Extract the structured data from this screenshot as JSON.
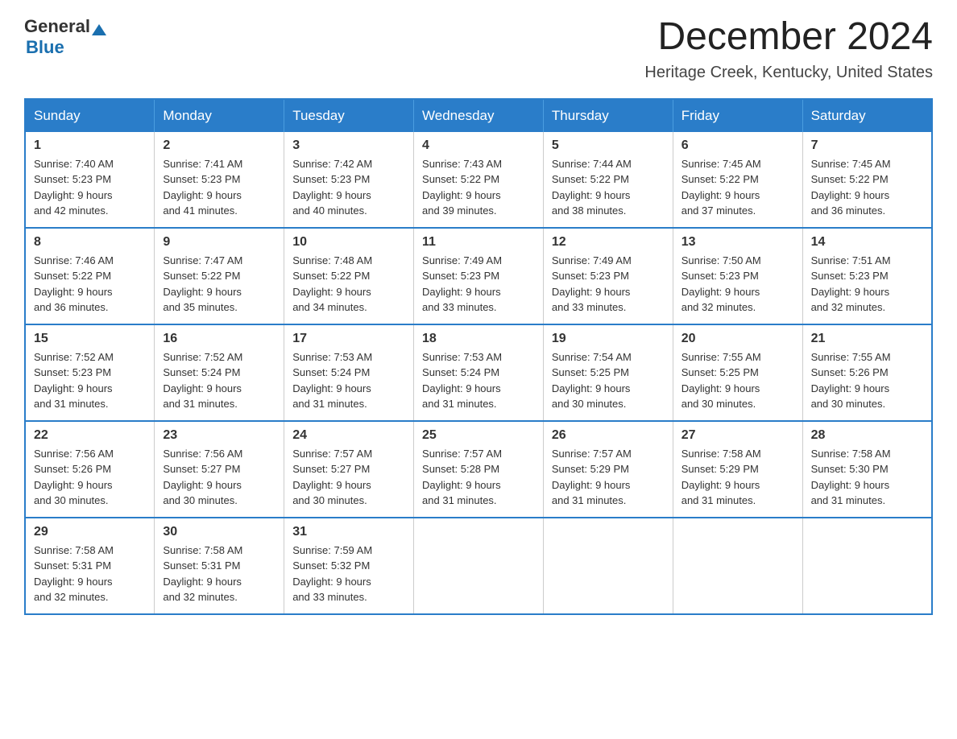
{
  "header": {
    "logo_general": "General",
    "logo_blue": "Blue",
    "month_title": "December 2024",
    "location": "Heritage Creek, Kentucky, United States"
  },
  "days_of_week": [
    "Sunday",
    "Monday",
    "Tuesday",
    "Wednesday",
    "Thursday",
    "Friday",
    "Saturday"
  ],
  "weeks": [
    [
      {
        "day": "1",
        "sunrise": "7:40 AM",
        "sunset": "5:23 PM",
        "daylight": "9 hours and 42 minutes."
      },
      {
        "day": "2",
        "sunrise": "7:41 AM",
        "sunset": "5:23 PM",
        "daylight": "9 hours and 41 minutes."
      },
      {
        "day": "3",
        "sunrise": "7:42 AM",
        "sunset": "5:23 PM",
        "daylight": "9 hours and 40 minutes."
      },
      {
        "day": "4",
        "sunrise": "7:43 AM",
        "sunset": "5:22 PM",
        "daylight": "9 hours and 39 minutes."
      },
      {
        "day": "5",
        "sunrise": "7:44 AM",
        "sunset": "5:22 PM",
        "daylight": "9 hours and 38 minutes."
      },
      {
        "day": "6",
        "sunrise": "7:45 AM",
        "sunset": "5:22 PM",
        "daylight": "9 hours and 37 minutes."
      },
      {
        "day": "7",
        "sunrise": "7:45 AM",
        "sunset": "5:22 PM",
        "daylight": "9 hours and 36 minutes."
      }
    ],
    [
      {
        "day": "8",
        "sunrise": "7:46 AM",
        "sunset": "5:22 PM",
        "daylight": "9 hours and 36 minutes."
      },
      {
        "day": "9",
        "sunrise": "7:47 AM",
        "sunset": "5:22 PM",
        "daylight": "9 hours and 35 minutes."
      },
      {
        "day": "10",
        "sunrise": "7:48 AM",
        "sunset": "5:22 PM",
        "daylight": "9 hours and 34 minutes."
      },
      {
        "day": "11",
        "sunrise": "7:49 AM",
        "sunset": "5:23 PM",
        "daylight": "9 hours and 33 minutes."
      },
      {
        "day": "12",
        "sunrise": "7:49 AM",
        "sunset": "5:23 PM",
        "daylight": "9 hours and 33 minutes."
      },
      {
        "day": "13",
        "sunrise": "7:50 AM",
        "sunset": "5:23 PM",
        "daylight": "9 hours and 32 minutes."
      },
      {
        "day": "14",
        "sunrise": "7:51 AM",
        "sunset": "5:23 PM",
        "daylight": "9 hours and 32 minutes."
      }
    ],
    [
      {
        "day": "15",
        "sunrise": "7:52 AM",
        "sunset": "5:23 PM",
        "daylight": "9 hours and 31 minutes."
      },
      {
        "day": "16",
        "sunrise": "7:52 AM",
        "sunset": "5:24 PM",
        "daylight": "9 hours and 31 minutes."
      },
      {
        "day": "17",
        "sunrise": "7:53 AM",
        "sunset": "5:24 PM",
        "daylight": "9 hours and 31 minutes."
      },
      {
        "day": "18",
        "sunrise": "7:53 AM",
        "sunset": "5:24 PM",
        "daylight": "9 hours and 31 minutes."
      },
      {
        "day": "19",
        "sunrise": "7:54 AM",
        "sunset": "5:25 PM",
        "daylight": "9 hours and 30 minutes."
      },
      {
        "day": "20",
        "sunrise": "7:55 AM",
        "sunset": "5:25 PM",
        "daylight": "9 hours and 30 minutes."
      },
      {
        "day": "21",
        "sunrise": "7:55 AM",
        "sunset": "5:26 PM",
        "daylight": "9 hours and 30 minutes."
      }
    ],
    [
      {
        "day": "22",
        "sunrise": "7:56 AM",
        "sunset": "5:26 PM",
        "daylight": "9 hours and 30 minutes."
      },
      {
        "day": "23",
        "sunrise": "7:56 AM",
        "sunset": "5:27 PM",
        "daylight": "9 hours and 30 minutes."
      },
      {
        "day": "24",
        "sunrise": "7:57 AM",
        "sunset": "5:27 PM",
        "daylight": "9 hours and 30 minutes."
      },
      {
        "day": "25",
        "sunrise": "7:57 AM",
        "sunset": "5:28 PM",
        "daylight": "9 hours and 31 minutes."
      },
      {
        "day": "26",
        "sunrise": "7:57 AM",
        "sunset": "5:29 PM",
        "daylight": "9 hours and 31 minutes."
      },
      {
        "day": "27",
        "sunrise": "7:58 AM",
        "sunset": "5:29 PM",
        "daylight": "9 hours and 31 minutes."
      },
      {
        "day": "28",
        "sunrise": "7:58 AM",
        "sunset": "5:30 PM",
        "daylight": "9 hours and 31 minutes."
      }
    ],
    [
      {
        "day": "29",
        "sunrise": "7:58 AM",
        "sunset": "5:31 PM",
        "daylight": "9 hours and 32 minutes."
      },
      {
        "day": "30",
        "sunrise": "7:58 AM",
        "sunset": "5:31 PM",
        "daylight": "9 hours and 32 minutes."
      },
      {
        "day": "31",
        "sunrise": "7:59 AM",
        "sunset": "5:32 PM",
        "daylight": "9 hours and 33 minutes."
      },
      null,
      null,
      null,
      null
    ]
  ],
  "labels": {
    "sunrise": "Sunrise:",
    "sunset": "Sunset:",
    "daylight": "Daylight:"
  }
}
